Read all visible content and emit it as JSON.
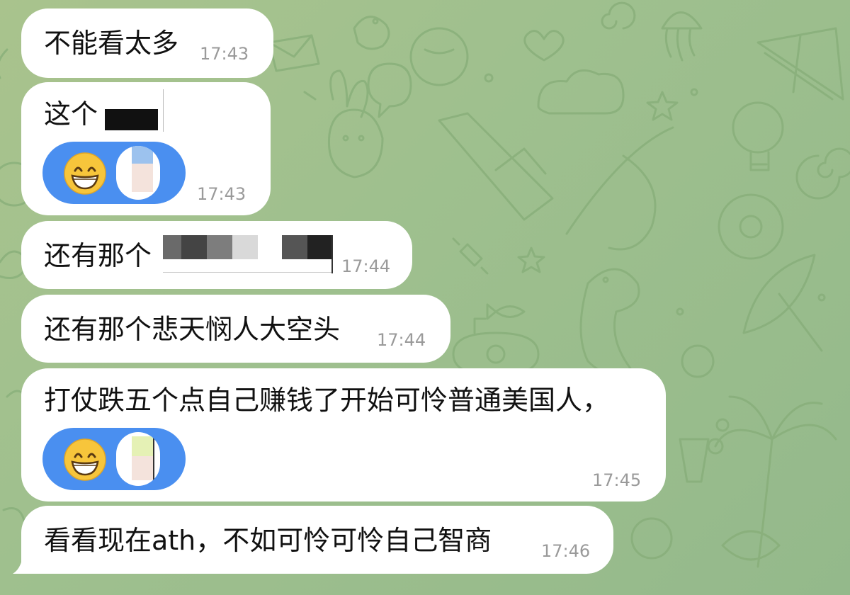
{
  "app": {
    "background_color": "#a3c28d",
    "bubble_color": "#ffffff",
    "reaction_color": "#4a8ff0"
  },
  "messages": [
    {
      "text": "不能看太多",
      "time": "17:43"
    },
    {
      "text": "这个",
      "time": "17:43",
      "reaction_icon": "grinning-face-emoji"
    },
    {
      "text": "还有那个",
      "time": "17:44"
    },
    {
      "text": "还有那个悲天悯人大空头",
      "time": "17:44"
    },
    {
      "text": "打仗跌五个点自己赚钱了开始可怜普通美国人，",
      "time": "17:45",
      "reaction_icon": "grinning-face-emoji"
    },
    {
      "text": "看看现在ath，不如可怜可怜自己智商",
      "time": "17:46"
    }
  ]
}
